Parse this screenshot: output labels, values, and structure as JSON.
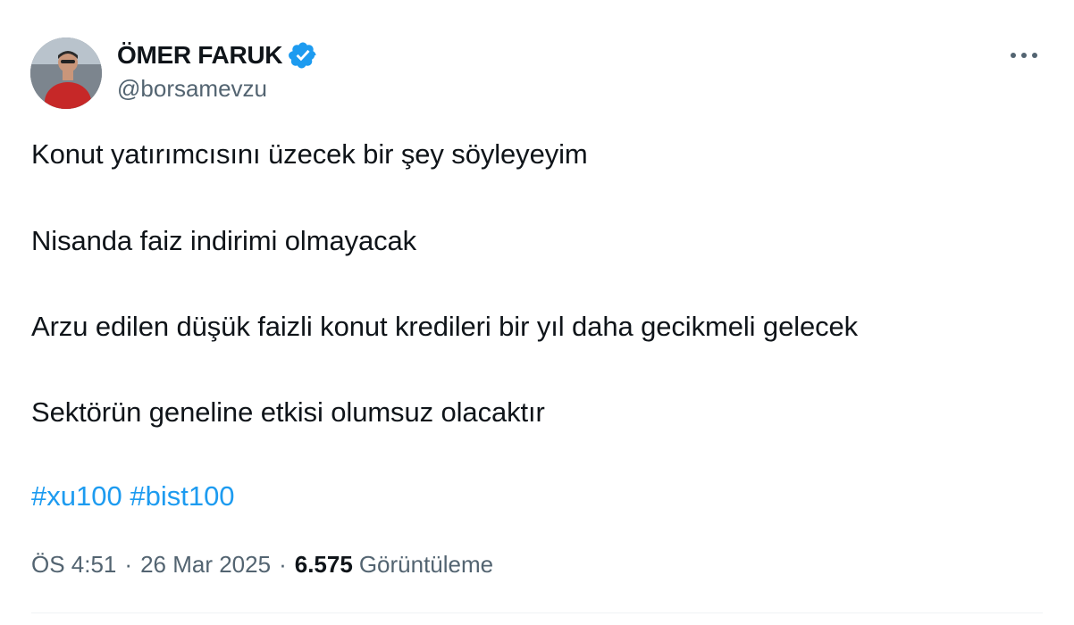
{
  "author": {
    "display_name": "ÖMER FARUK",
    "handle": "@borsamevzu",
    "verified": true,
    "verified_color": "#1d9bf0"
  },
  "tweet": {
    "lines": [
      "Konut yatırımcısını üzecek bir şey söyleyeyim",
      "Nisanda faiz indirimi olmayacak",
      "Arzu edilen düşük faizli konut kredileri bir yıl daha gecikmeli gelecek",
      "Sektörün geneline etkisi olumsuz olacaktır"
    ],
    "hashtags": [
      "#xu100",
      "#bist100"
    ]
  },
  "meta": {
    "time": "ÖS 4:51",
    "separator": "·",
    "date": "26 Mar 2025",
    "views_count": "6.575",
    "views_label": "Görüntüleme"
  },
  "icons": {
    "more": "more-horizontal-icon",
    "verified": "verified-badge-icon"
  },
  "colors": {
    "text_primary": "#0f1419",
    "text_secondary": "#536471",
    "link": "#1d9bf0"
  }
}
